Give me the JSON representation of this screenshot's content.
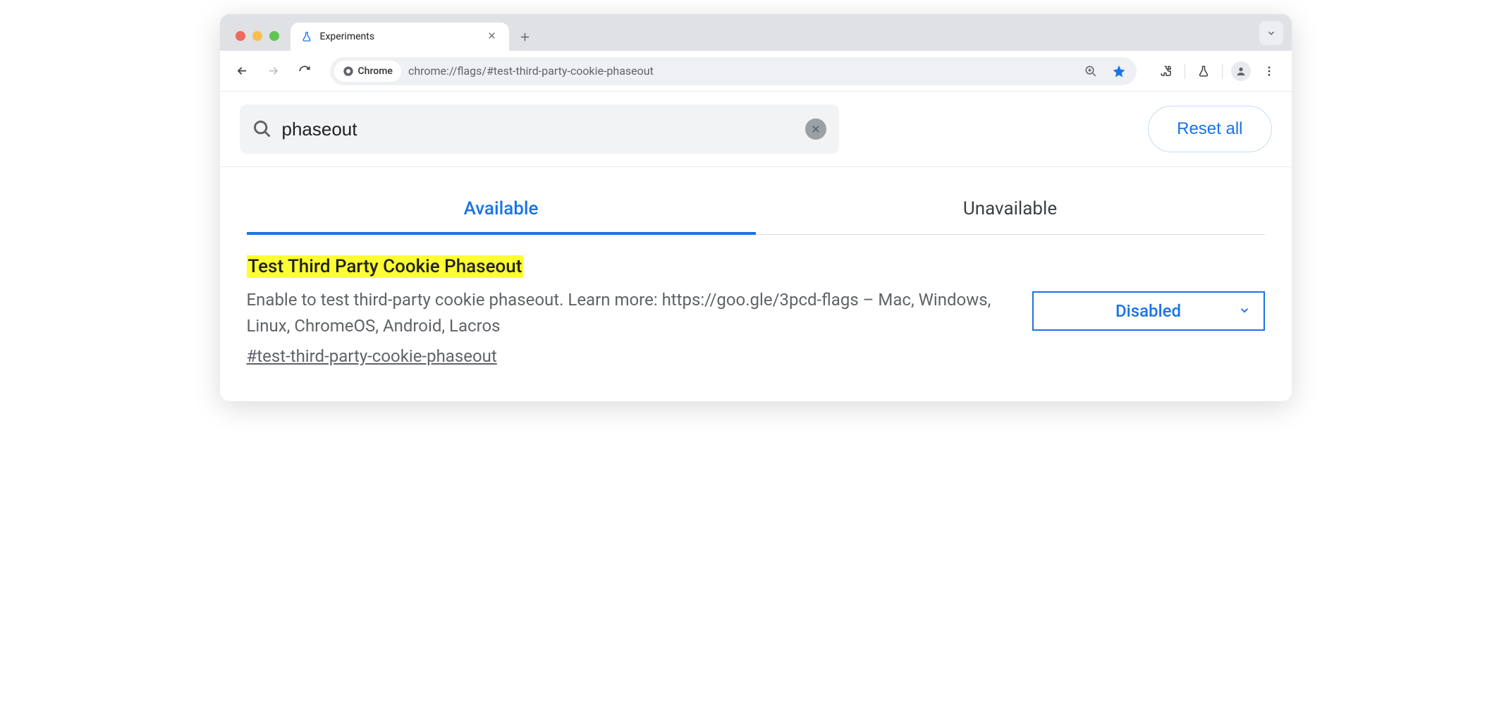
{
  "window": {
    "tab_title": "Experiments",
    "url": "chrome://flags/#test-third-party-cookie-phaseout",
    "omnibox_chip": "Chrome"
  },
  "search": {
    "value": "phaseout",
    "reset_label": "Reset all"
  },
  "tabs": {
    "available": "Available",
    "unavailable": "Unavailable"
  },
  "flag": {
    "title": "Test Third Party Cookie Phaseout",
    "description": "Enable to test third-party cookie phaseout. Learn more: https://goo.gle/3pcd-flags – Mac, Windows, Linux, ChromeOS, Android, Lacros",
    "hash": "#test-third-party-cookie-phaseout",
    "select_value": "Disabled"
  }
}
